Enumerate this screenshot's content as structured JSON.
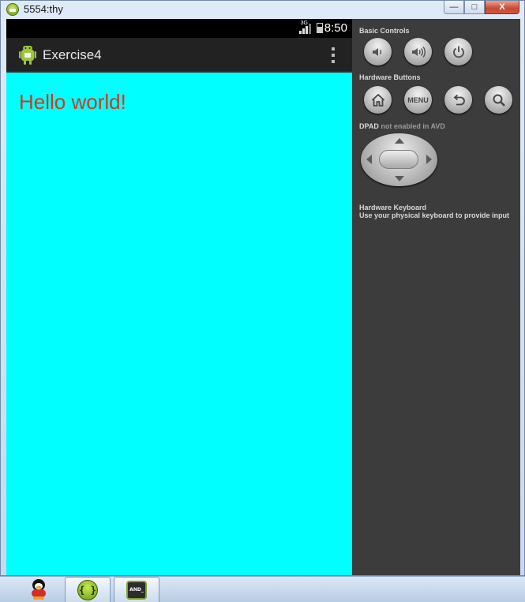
{
  "window": {
    "title": "5554:thy",
    "buttons": {
      "minimize": "—",
      "maximize": "□",
      "close": "X"
    }
  },
  "phone": {
    "status_bar": {
      "network": "3G",
      "time": "8:50"
    },
    "action_bar": {
      "app_title": "Exercise4"
    },
    "content": {
      "text": "Hello world!",
      "background": "#00ffff",
      "text_color": "#d03a1e"
    }
  },
  "controls": {
    "basic_controls_label": "Basic Controls",
    "hardware_buttons_label": "Hardware Buttons",
    "menu_label": "MENU",
    "dpad_label": "DPAD",
    "dpad_note": "not enabled in AVD",
    "keyboard_label": "Hardware Keyboard",
    "keyboard_note": "Use your physical keyboard to provide input",
    "icons": [
      "volume-down-icon",
      "volume-up-icon",
      "power-icon",
      "home-icon",
      "menu-icon",
      "back-icon",
      "search-icon"
    ]
  },
  "taskbar": {
    "items": [
      {
        "icon": "qq-penguin-icon"
      },
      {
        "icon": "eclipse-braces-icon",
        "label": "{ }"
      },
      {
        "icon": "android-terminal-icon",
        "label": "AND_"
      }
    ]
  }
}
